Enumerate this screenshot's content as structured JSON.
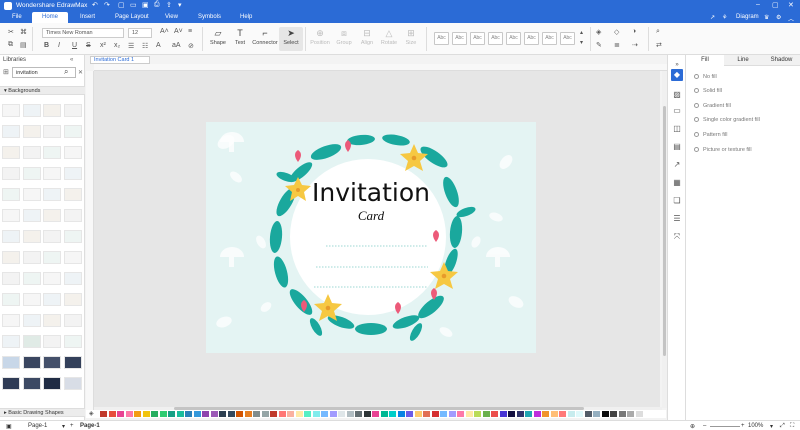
{
  "app": {
    "title": "Wondershare EdrawMax"
  },
  "menu": {
    "items": [
      "File",
      "Home",
      "Insert",
      "Page Layout",
      "View",
      "Symbols",
      "Help"
    ],
    "active": "Home"
  },
  "topright": {
    "diagram_label": "Diagram"
  },
  "ribbon": {
    "font_name": "Times New Roman",
    "font_size": "12",
    "tools": [
      "Shape",
      "Text",
      "Connector",
      "Select"
    ],
    "disabled_tools": [
      "Position",
      "Group",
      "Align",
      "Rotate",
      "Size"
    ],
    "style_label": "Abc",
    "style_count": 8
  },
  "libraries": {
    "title": "Libraries",
    "search_value": "invitation",
    "section_backgrounds": "Backgrounds",
    "section_basic": "Basic Drawing Shapes"
  },
  "document": {
    "tab_title": "Invitation Card 1"
  },
  "card": {
    "title": "Invitation",
    "subtitle": "Card"
  },
  "right_panel": {
    "tabs": [
      "Fill",
      "Line",
      "Shadow"
    ],
    "active_tab": "Fill",
    "options": [
      "No fill",
      "Solid fill",
      "Gradient fill",
      "Single color gradient fill",
      "Pattern fill",
      "Picture or texture fill"
    ]
  },
  "status": {
    "page_selector": "Page-1",
    "page_tab": "Page-1",
    "zoom": "100%"
  },
  "colors": {
    "accent": "#2b6bd6",
    "card_bg": "#e4f4f3",
    "leaf": "#1aa89d",
    "flower_pink": "#ec5a79",
    "flower_yellow": "#f6c842"
  },
  "palette": [
    "#c0392b",
    "#e74c3c",
    "#e84393",
    "#fd79a8",
    "#f39c12",
    "#f1c40f",
    "#27ae60",
    "#2ecc71",
    "#16a085",
    "#1abc9c",
    "#2980b9",
    "#3498db",
    "#8e44ad",
    "#9b59b6",
    "#2c3e50",
    "#34495e",
    "#d35400",
    "#e67e22",
    "#7f8c8d",
    "#95a5a6",
    "#c0392b",
    "#ff7675",
    "#fab1a0",
    "#ffeaa7",
    "#55efc4",
    "#81ecec",
    "#74b9ff",
    "#a29bfe",
    "#dfe6e9",
    "#b2bec3",
    "#636e72",
    "#2d3436",
    "#e84393",
    "#00b894",
    "#00cec9",
    "#0984e3",
    "#6c5ce7",
    "#fdcb6e",
    "#e17055",
    "#d63031",
    "#74b9ff",
    "#a29bfe",
    "#fd79a8",
    "#ffeaa7",
    "#badc58",
    "#6ab04c",
    "#eb4d4b",
    "#4834d4",
    "#130f40",
    "#30336b",
    "#22a6b3",
    "#be2edd",
    "#f0932b",
    "#ffbe76",
    "#ff7979",
    "#c7ecee",
    "#dff9fb",
    "#535c68",
    "#95afc0",
    "#0b0b0b",
    "#444444",
    "#777777",
    "#aaaaaa",
    "#dddddd",
    "#ffffff"
  ]
}
